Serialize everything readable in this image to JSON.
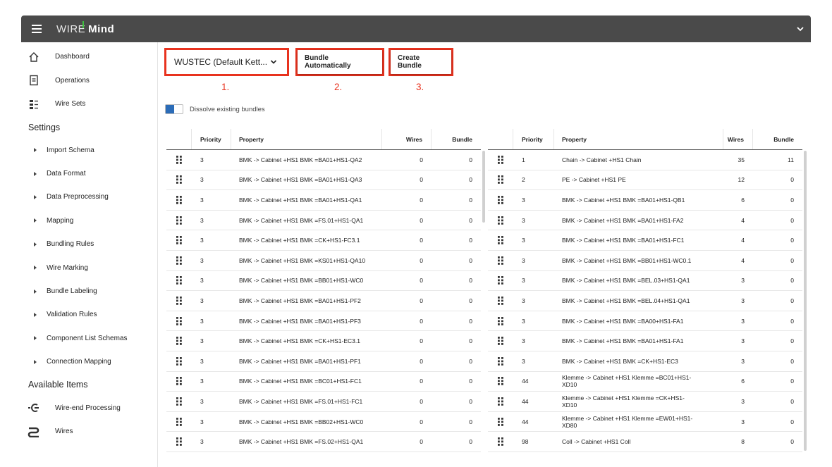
{
  "app": {
    "logo_prefix": "WIRE",
    "logo_suffix": "Mind",
    "logo_accent": "#3fbf3f",
    "topbar_bg": "#4a4a4a"
  },
  "sidebar": {
    "main": [
      {
        "label": "Dashboard",
        "icon": "home-icon"
      },
      {
        "label": "Operations",
        "icon": "document-icon"
      },
      {
        "label": "Wire Sets",
        "icon": "wire-sets-icon"
      }
    ],
    "settings_title": "Settings",
    "settings": [
      "Import Schema",
      "Data Format",
      "Data Preprocessing",
      "Mapping",
      "Bundling Rules",
      "Wire Marking",
      "Bundle Labeling",
      "Validation Rules",
      "Component List Schemas",
      "Connection Mapping"
    ],
    "available_title": "Available Items",
    "available": [
      {
        "label": "Wire-end Processing",
        "icon": "wire-end-icon"
      },
      {
        "label": "Wires",
        "icon": "wire-icon"
      }
    ]
  },
  "controls": {
    "select_value": "WUSTEC (Default Kett...",
    "bundle_auto_label": "Bundle Automatically",
    "create_bundle_label": "Create Bundle",
    "step1": "1.",
    "step2": "2.",
    "step3": "3.",
    "highlight_color": "#e8321e",
    "toggle_label": "Dissolve existing bundles",
    "toggle_color": "#2b6cb8"
  },
  "left_table": {
    "headers": {
      "priority": "Priority",
      "property": "Property",
      "wires": "Wires",
      "bundle": "Bundle"
    },
    "rows": [
      {
        "priority": "3",
        "property": "BMK -> Cabinet +HS1 BMK =BA01+HS1-QA2",
        "wires": "0",
        "bundle": "0"
      },
      {
        "priority": "3",
        "property": "BMK -> Cabinet +HS1 BMK =BA01+HS1-QA3",
        "wires": "0",
        "bundle": "0"
      },
      {
        "priority": "3",
        "property": "BMK -> Cabinet +HS1 BMK =BA01+HS1-QA1",
        "wires": "0",
        "bundle": "0"
      },
      {
        "priority": "3",
        "property": "BMK -> Cabinet +HS1 BMK =FS.01+HS1-QA1",
        "wires": "0",
        "bundle": "0"
      },
      {
        "priority": "3",
        "property": "BMK -> Cabinet +HS1 BMK =CK+HS1-FC3.1",
        "wires": "0",
        "bundle": "0"
      },
      {
        "priority": "3",
        "property": "BMK -> Cabinet +HS1 BMK =KS01+HS1-QA10",
        "wires": "0",
        "bundle": "0"
      },
      {
        "priority": "3",
        "property": "BMK -> Cabinet +HS1 BMK =BB01+HS1-WC0",
        "wires": "0",
        "bundle": "0"
      },
      {
        "priority": "3",
        "property": "BMK -> Cabinet +HS1 BMK =BA01+HS1-PF2",
        "wires": "0",
        "bundle": "0"
      },
      {
        "priority": "3",
        "property": "BMK -> Cabinet +HS1 BMK =BA01+HS1-PF3",
        "wires": "0",
        "bundle": "0"
      },
      {
        "priority": "3",
        "property": "BMK -> Cabinet +HS1 BMK =CK+HS1-EC3.1",
        "wires": "0",
        "bundle": "0"
      },
      {
        "priority": "3",
        "property": "BMK -> Cabinet +HS1 BMK =BA01+HS1-PF1",
        "wires": "0",
        "bundle": "0"
      },
      {
        "priority": "3",
        "property": "BMK -> Cabinet +HS1 BMK =BC01+HS1-FC1",
        "wires": "0",
        "bundle": "0"
      },
      {
        "priority": "3",
        "property": "BMK -> Cabinet +HS1 BMK =FS.01+HS1-FC1",
        "wires": "0",
        "bundle": "0"
      },
      {
        "priority": "3",
        "property": "BMK -> Cabinet +HS1 BMK =BB02+HS1-WC0",
        "wires": "0",
        "bundle": "0"
      },
      {
        "priority": "3",
        "property": "BMK -> Cabinet +HS1 BMK =FS.02+HS1-QA1",
        "wires": "0",
        "bundle": "0"
      }
    ]
  },
  "right_table": {
    "headers": {
      "priority": "Priority",
      "property": "Property",
      "wires": "Wires",
      "bundle": "Bundle"
    },
    "rows": [
      {
        "priority": "1",
        "property": "Chain -> Cabinet +HS1 Chain",
        "wires": "35",
        "bundle": "11"
      },
      {
        "priority": "2",
        "property": "PE -> Cabinet +HS1 PE",
        "wires": "12",
        "bundle": "0"
      },
      {
        "priority": "3",
        "property": "BMK -> Cabinet +HS1 BMK =BA01+HS1-QB1",
        "wires": "6",
        "bundle": "0"
      },
      {
        "priority": "3",
        "property": "BMK -> Cabinet +HS1 BMK =BA01+HS1-FA2",
        "wires": "4",
        "bundle": "0"
      },
      {
        "priority": "3",
        "property": "BMK -> Cabinet +HS1 BMK =BA01+HS1-FC1",
        "wires": "4",
        "bundle": "0"
      },
      {
        "priority": "3",
        "property": "BMK -> Cabinet +HS1 BMK =BB01+HS1-WC0.1",
        "wires": "4",
        "bundle": "0"
      },
      {
        "priority": "3",
        "property": "BMK -> Cabinet +HS1 BMK =BEL.03+HS1-QA1",
        "wires": "3",
        "bundle": "0"
      },
      {
        "priority": "3",
        "property": "BMK -> Cabinet +HS1 BMK =BEL.04+HS1-QA1",
        "wires": "3",
        "bundle": "0"
      },
      {
        "priority": "3",
        "property": "BMK -> Cabinet +HS1 BMK =BA00+HS1-FA1",
        "wires": "3",
        "bundle": "0"
      },
      {
        "priority": "3",
        "property": "BMK -> Cabinet +HS1 BMK =BA01+HS1-FA1",
        "wires": "3",
        "bundle": "0"
      },
      {
        "priority": "3",
        "property": "BMK -> Cabinet +HS1 BMK =CK+HS1-EC3",
        "wires": "3",
        "bundle": "0"
      },
      {
        "priority": "44",
        "property": "Klemme -> Cabinet +HS1 Klemme =BC01+HS1-XD10",
        "wires": "6",
        "bundle": "0"
      },
      {
        "priority": "44",
        "property": "Klemme -> Cabinet +HS1 Klemme =CK+HS1-XD10",
        "wires": "3",
        "bundle": "0"
      },
      {
        "priority": "44",
        "property": "Klemme -> Cabinet +HS1 Klemme =EW01+HS1-XD80",
        "wires": "3",
        "bundle": "0"
      },
      {
        "priority": "98",
        "property": "Coll -> Cabinet +HS1 Coll",
        "wires": "8",
        "bundle": "0"
      }
    ]
  }
}
